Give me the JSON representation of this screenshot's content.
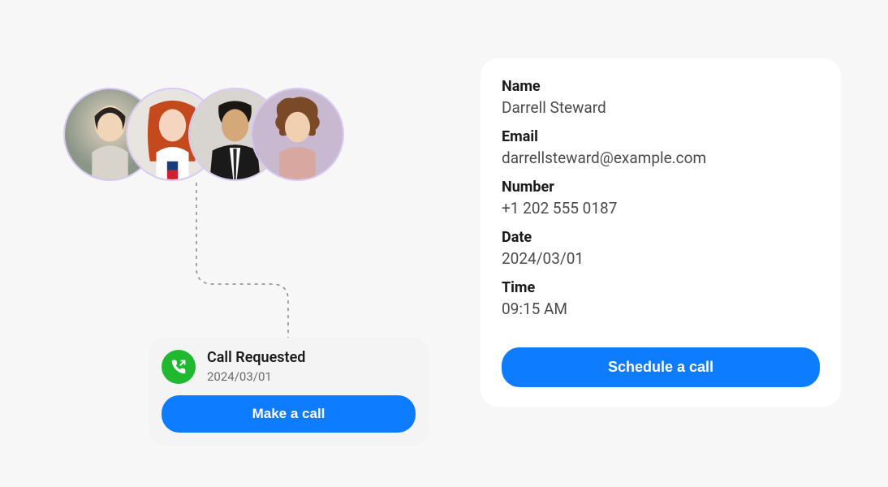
{
  "avatars": [
    {
      "semantic": "avatar-1"
    },
    {
      "semantic": "avatar-2"
    },
    {
      "semantic": "avatar-3"
    },
    {
      "semantic": "avatar-4"
    }
  ],
  "call_card": {
    "title": "Call Requested",
    "date": "2024/03/01",
    "button_label": "Make a call"
  },
  "detail_card": {
    "name_label": "Name",
    "name_value": "Darrell Steward",
    "email_label": "Email",
    "email_value": "darrellsteward@example.com",
    "number_label": "Number",
    "number_value": "+1 202 555 0187",
    "date_label": "Date",
    "date_value": "2024/03/01",
    "time_label": "Time",
    "time_value": "09:15 AM",
    "button_label": "Schedule a call"
  }
}
